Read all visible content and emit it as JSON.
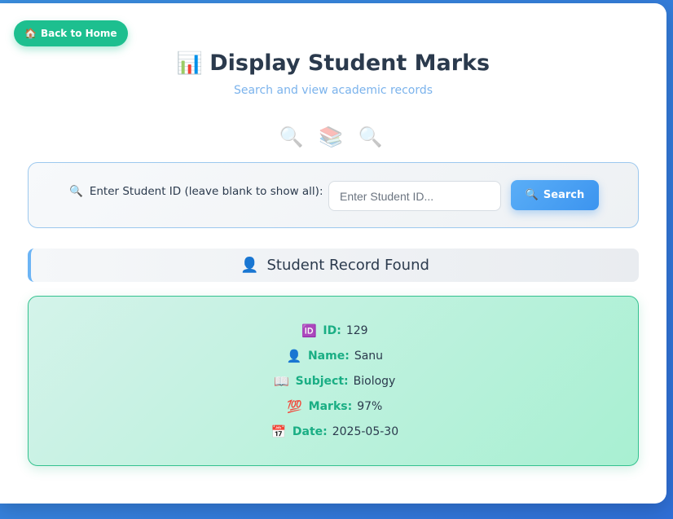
{
  "nav": {
    "back_icon": "🏠",
    "back_label": "Back to Home"
  },
  "header": {
    "title_icon": "📊",
    "title": "Display Student Marks",
    "subtitle": "Search and view academic records",
    "decor": "🔍 📚 🔍"
  },
  "search": {
    "label_icon": "🔍",
    "label": "Enter Student ID (leave blank to show all):",
    "input_value": "",
    "placeholder": "Enter Student ID...",
    "button_icon": "🔍",
    "button_label": "Search"
  },
  "result": {
    "header_icon": "👤",
    "header": "Student Record Found",
    "fields": [
      {
        "icon": "🆔",
        "label": "ID:",
        "value": "129"
      },
      {
        "icon": "👤",
        "label": "Name:",
        "value": "Sanu"
      },
      {
        "icon": "📖",
        "label": "Subject:",
        "value": "Biology"
      },
      {
        "icon": "💯",
        "label": "Marks:",
        "value": "97%"
      },
      {
        "icon": "📅",
        "label": "Date:",
        "value": "2025-05-30"
      }
    ]
  },
  "colors": {
    "accent_green": "#1dbf8f",
    "accent_blue": "#3c94ef",
    "title_text": "#2b3a4d",
    "subtitle_text": "#7bb3ec"
  }
}
